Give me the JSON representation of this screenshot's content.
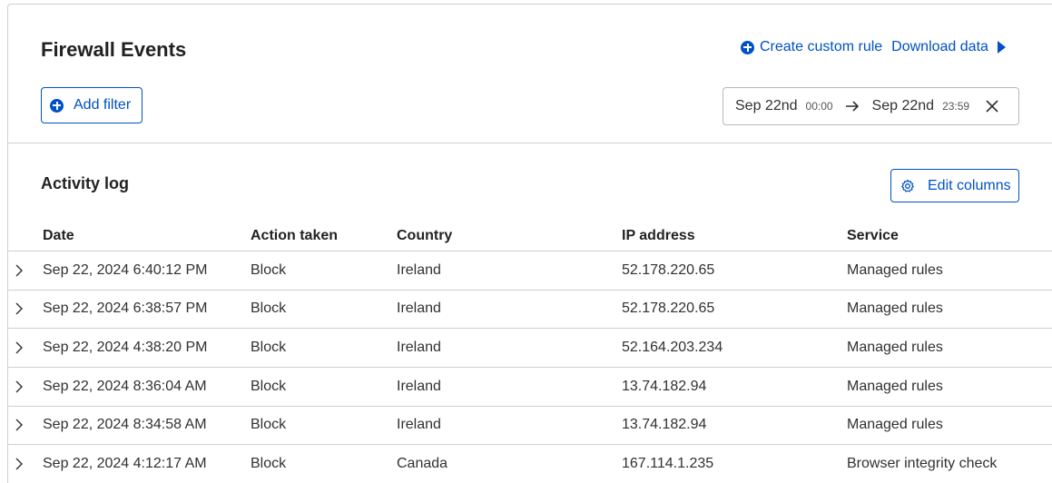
{
  "header": {
    "title": "Firewall Events",
    "create_rule_label": "Create custom rule",
    "download_label": "Download data"
  },
  "filter": {
    "add_filter_label": "Add filter"
  },
  "date_range": {
    "start_date": "Sep 22nd",
    "start_time": "00:00",
    "end_date": "Sep 22nd",
    "end_time": "23:59"
  },
  "activity": {
    "title": "Activity log",
    "edit_columns_label": "Edit columns",
    "columns": [
      "Date",
      "Action taken",
      "Country",
      "IP address",
      "Service"
    ],
    "rows": [
      [
        "Sep 22, 2024 6:40:12 PM",
        "Block",
        "Ireland",
        "52.178.220.65",
        "Managed rules"
      ],
      [
        "Sep 22, 2024 6:38:57 PM",
        "Block",
        "Ireland",
        "52.178.220.65",
        "Managed rules"
      ],
      [
        "Sep 22, 2024 4:38:20 PM",
        "Block",
        "Ireland",
        "52.164.203.234",
        "Managed rules"
      ],
      [
        "Sep 22, 2024 8:36:04 AM",
        "Block",
        "Ireland",
        "13.74.182.94",
        "Managed rules"
      ],
      [
        "Sep 22, 2024 8:34:58 AM",
        "Block",
        "Ireland",
        "13.74.182.94",
        "Managed rules"
      ],
      [
        "Sep 22, 2024 4:12:17 AM",
        "Block",
        "Canada",
        "167.114.1.235",
        "Browser integrity check"
      ]
    ]
  },
  "icons": {
    "plus": "plus-circle-icon",
    "play": "triangle-right-icon",
    "arrow": "arrow-right-icon",
    "close": "close-icon",
    "gear": "gear-icon",
    "expand": "chevron-right-icon"
  },
  "colors": {
    "accent": "#0051c3",
    "border": "#cfcfcf",
    "text": "#313131"
  }
}
